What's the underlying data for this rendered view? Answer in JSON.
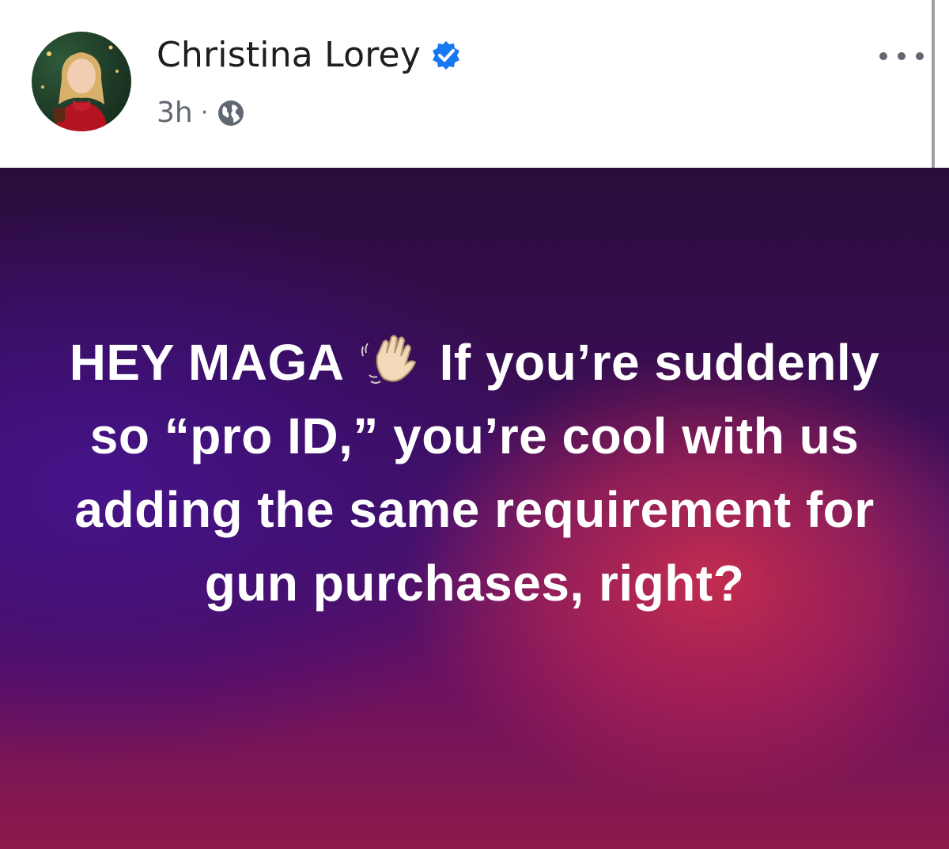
{
  "post": {
    "author": {
      "name": "Christina Lorey",
      "verified": true,
      "avatar_icon": "profile-photo"
    },
    "meta": {
      "timestamp": "3h",
      "separator": "·",
      "audience_icon": "globe-icon"
    },
    "more_icon": "more-options-icon",
    "body": {
      "before_emoji": "HEY MAGA",
      "emoji_icon": "waving-hand-icon",
      "after_emoji": "If you’re suddenly so “pro ID,” you’re cool with us adding the same requirement for gun purchases, right?"
    }
  },
  "colors": {
    "author_text": "#1c1e21",
    "meta_text": "#606770",
    "verified_badge": "#1877f2",
    "background_top": "#2a0d3c",
    "background_accent": "#d6304a",
    "post_text": "#ffffff"
  }
}
